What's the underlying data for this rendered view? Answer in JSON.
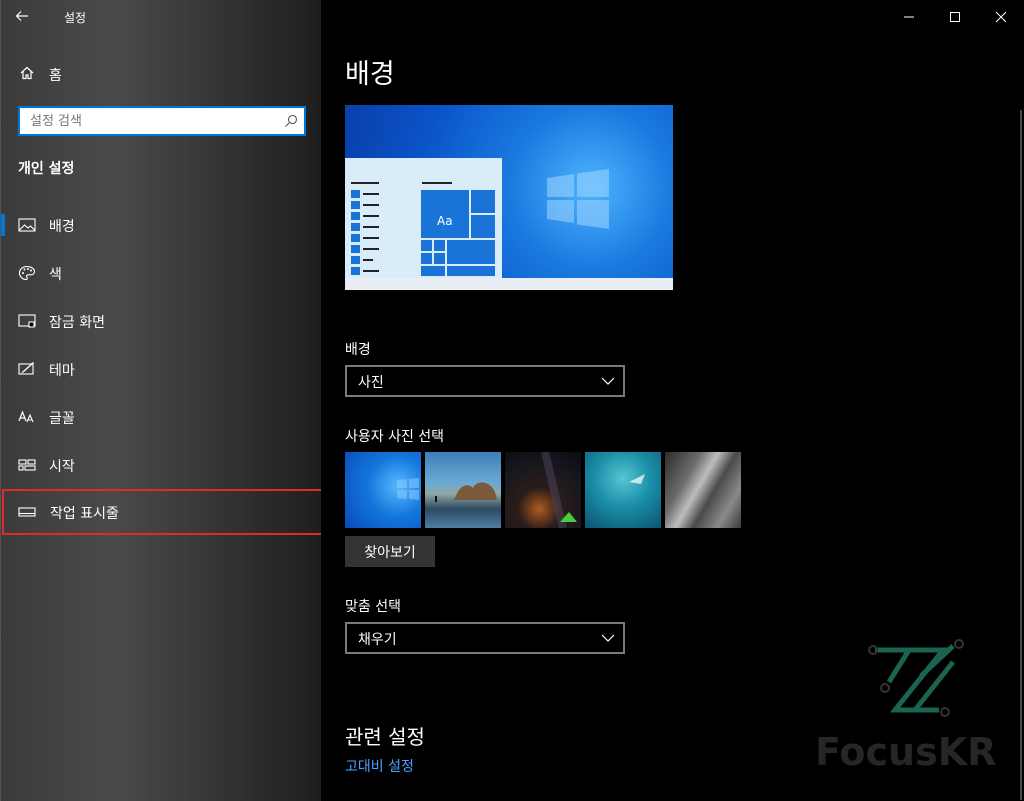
{
  "window": {
    "title": "설정",
    "controls": [
      "minimize",
      "maximize",
      "close"
    ]
  },
  "sidebar": {
    "home_label": "홈",
    "search": {
      "placeholder": "설정 검색",
      "value": ""
    },
    "section_title": "개인 설정",
    "items": [
      {
        "label": "배경",
        "icon": "image-icon",
        "selected": true
      },
      {
        "label": "색",
        "icon": "palette-icon",
        "selected": false
      },
      {
        "label": "잠금 화면",
        "icon": "lock-screen-icon",
        "selected": false
      },
      {
        "label": "테마",
        "icon": "theme-icon",
        "selected": false
      },
      {
        "label": "글꼴",
        "icon": "font-icon",
        "selected": false
      },
      {
        "label": "시작",
        "icon": "start-icon",
        "selected": false
      },
      {
        "label": "작업 표시줄",
        "icon": "taskbar-icon",
        "selected": false,
        "highlighted": true
      }
    ]
  },
  "main": {
    "page_title": "배경",
    "preview": {
      "tile_label": "Aa"
    },
    "background_field": {
      "label": "배경",
      "value": "사진"
    },
    "choose_picture": {
      "label": "사용자 사진 선택",
      "browse_label": "찾아보기"
    },
    "fit_field": {
      "label": "맞춤 선택",
      "value": "채우기"
    },
    "related": {
      "title": "관련 설정",
      "links": [
        "고대비 설정"
      ]
    }
  },
  "watermark": {
    "text": "FocusKR"
  },
  "colors": {
    "accent": "#0078d7",
    "highlight_border": "#e0282e",
    "link": "#4aa3ff"
  }
}
